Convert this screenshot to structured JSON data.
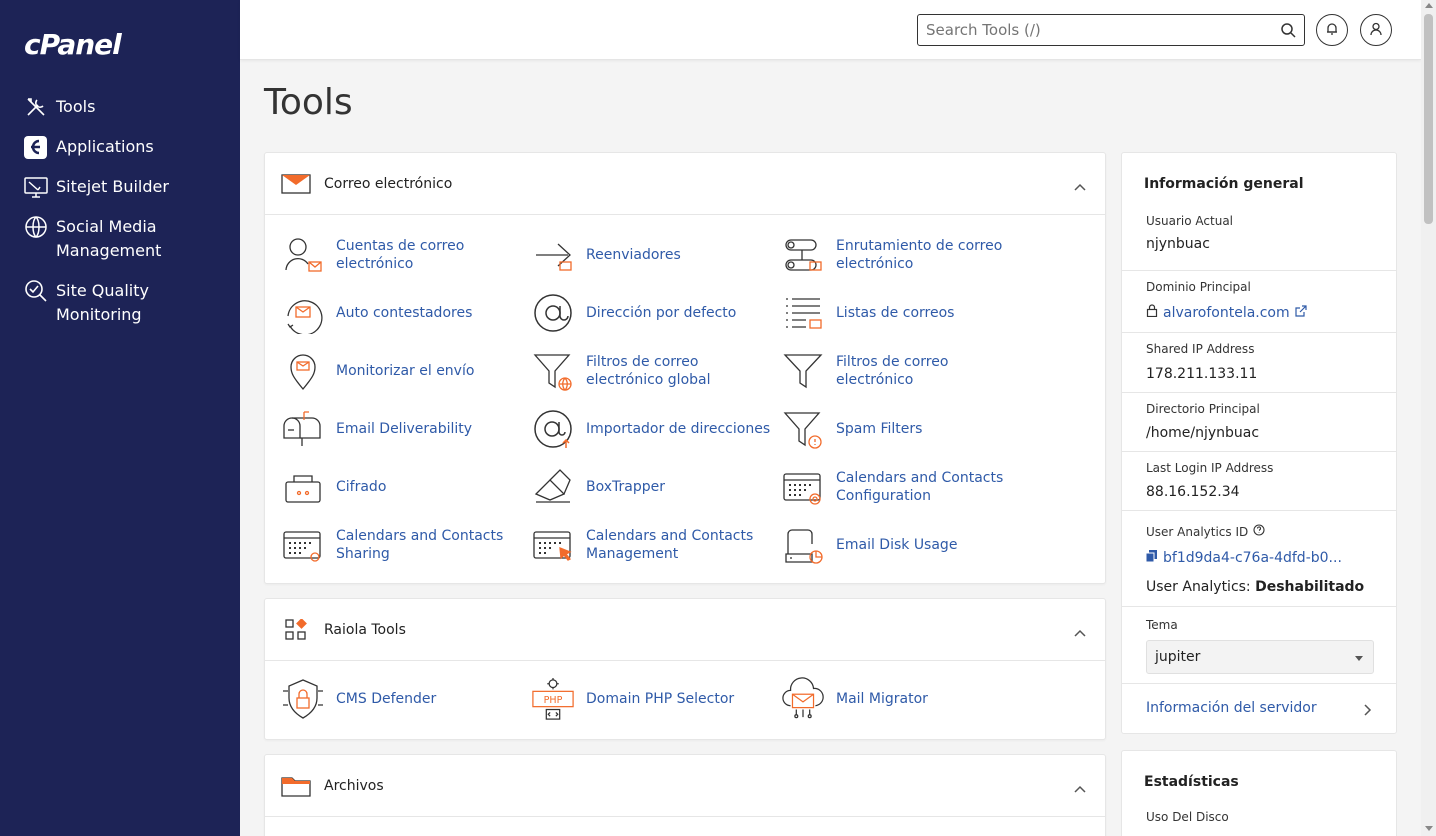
{
  "sidebar": {
    "logo": "cPanel",
    "items": [
      {
        "label": "Tools",
        "icon": "tools-icon"
      },
      {
        "label": "Applications",
        "icon": "applications-icon"
      },
      {
        "label": "Sitejet Builder",
        "icon": "sitejet-icon"
      },
      {
        "label": "Social Media Management",
        "icon": "social-media-icon"
      },
      {
        "label": "Site Quality Monitoring",
        "icon": "site-quality-icon"
      }
    ]
  },
  "header": {
    "search_placeholder": "Search Tools (/)"
  },
  "page": {
    "title": "Tools"
  },
  "panels": {
    "email": {
      "title": "Correo electrónico",
      "tools": [
        "Cuentas de correo electrónico",
        "Reenviadores",
        "Enrutamiento de correo electrónico",
        "Auto contestadores",
        "Dirección por defecto",
        "Listas de correos",
        "Monitorizar el envío",
        "Filtros de correo electrónico global",
        "Filtros de correo electrónico",
        "Email Deliverability",
        "Importador de direcciones",
        "Spam Filters",
        "Cifrado",
        "BoxTrapper",
        "Calendars and Contacts Configuration",
        "Calendars and Contacts Sharing",
        "Calendars and Contacts Management",
        "Email Disk Usage"
      ]
    },
    "raiola": {
      "title": "Raiola Tools",
      "tools": [
        "CMS Defender",
        "Domain PHP Selector",
        "Mail Migrator"
      ]
    },
    "files": {
      "title": "Archivos"
    }
  },
  "info": {
    "title": "Información general",
    "current_user_label": "Usuario Actual",
    "current_user": "njynbuac",
    "primary_domain_label": "Dominio Principal",
    "primary_domain": "alvarofontela.com",
    "shared_ip_label": "Shared IP Address",
    "shared_ip": "178.211.133.11",
    "home_dir_label": "Directorio Principal",
    "home_dir": "/home/njynbuac",
    "last_login_label": "Last Login IP Address",
    "last_login": "88.16.152.34",
    "analytics_id_label": "User Analytics ID",
    "analytics_id": "bf1d9da4-c76a-4dfd-b0...",
    "analytics_status_label": "User Analytics:",
    "analytics_status": "Deshabilitado",
    "theme_label": "Tema",
    "theme": "jupiter",
    "server_info": "Información del servidor"
  },
  "stats": {
    "title": "Estadísticas",
    "disk_label": "Uso Del Disco"
  },
  "colors": {
    "sidebar_bg": "#1d2356",
    "accent_orange": "#f26b2b",
    "link_blue": "#2f5aa8"
  }
}
